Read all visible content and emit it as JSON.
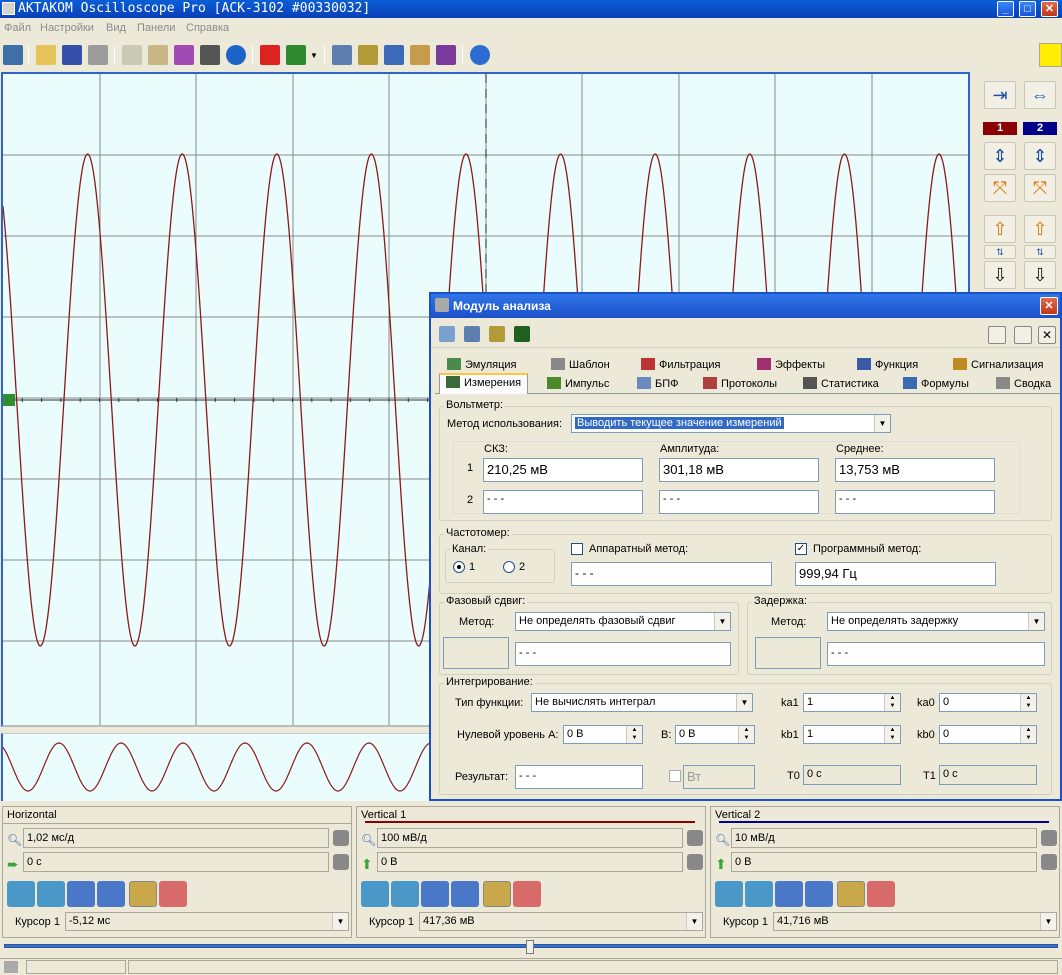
{
  "window": {
    "title": "AKTAKOM Oscilloscope Pro [ACK-3102 #00330032]"
  },
  "menu": [
    "Файл",
    "Настройки",
    "Вид",
    "Панели",
    "Справка"
  ],
  "icons": {
    "app": "oscilloscope-app-icon",
    "minimize": "minimize-icon",
    "maximize": "maximize-icon",
    "close": "close-icon"
  },
  "colors": {
    "trace": "#8b1a1a",
    "grid": "#8a8a8a",
    "screen": "#ebfcfc",
    "ch1": "#8b0000",
    "ch2": "#00008b",
    "accent": "#1c50c8"
  },
  "right_panel": {
    "ch1_label": "1",
    "ch2_label": "2"
  },
  "analysis": {
    "title": "Модуль анализа",
    "tabs_row1": [
      "Эмуляция",
      "Шаблон",
      "Фильтрация",
      "Эффекты",
      "Функция",
      "Сигнализация"
    ],
    "tabs_row2": [
      "Измерения",
      "Импульс",
      "БПФ",
      "Протоколы",
      "Статистика",
      "Формулы",
      "Сводка"
    ],
    "voltmeter": {
      "group": "Вольтметр:",
      "method_label": "Метод использования:",
      "method_value": "Выводить текущее значение измерений",
      "col_rms": "СКЗ:",
      "col_amp": "Амплитуда:",
      "col_avg": "Среднее:",
      "rows": [
        {
          "n": "1",
          "rms": "210,25 мВ",
          "amp": "301,18 мВ",
          "avg": "13,753 мВ"
        },
        {
          "n": "2",
          "rms": "- - -",
          "amp": "- - -",
          "avg": "- - -"
        }
      ]
    },
    "freq": {
      "group": "Частотомер:",
      "channel_label": "Канал:",
      "ch1": "1",
      "ch2": "2",
      "hw_label": "Аппаратный метод:",
      "hw_value": "- - -",
      "sw_label": "Программный метод:",
      "sw_value": "999,94 Гц"
    },
    "phase": {
      "group": "Фазовый сдвиг:",
      "method_label": "Метод:",
      "method_value": "Не определять фазовый сдвиг",
      "value": "- - -"
    },
    "delay": {
      "group": "Задержка:",
      "method_label": "Метод:",
      "method_value": "Не определять задержку",
      "value": "- - -"
    },
    "integr": {
      "group": "Интегрирование:",
      "type_label": "Тип функции:",
      "type_value": "Не вычислять интеграл",
      "zero_label": "Нулевой уровень А:",
      "zero_a": "0 В",
      "b_label": "В:",
      "zero_b": "0 В",
      "ka1_label": "ka1",
      "ka1": "1",
      "ka0_label": "ka0",
      "ka0": "0",
      "kb1_label": "kb1",
      "kb1": "1",
      "kb0_label": "kb0",
      "kb0": "0",
      "result_label": "Результат:",
      "result": "- - -",
      "unit": "Вт",
      "t0_label": "T0",
      "t0": "0 с",
      "t1_label": "T1",
      "t1": "0 с"
    }
  },
  "horizontal": {
    "title": "Horizontal",
    "scale": "1,02 мс/д",
    "offset": "0 с",
    "cursor_label": "Курсор 1",
    "cursor_value": "-5,12 мс"
  },
  "vertical1": {
    "title": "Vertical 1",
    "scale": "100 мВ/д",
    "offset": "0 В",
    "cursor_label": "Курсор 1",
    "cursor_value": "417,36 мВ"
  },
  "vertical2": {
    "title": "Vertical 2",
    "scale": "10 мВ/д",
    "offset": "0 В",
    "cursor_label": "Курсор 1",
    "cursor_value": "41,716 мВ"
  }
}
